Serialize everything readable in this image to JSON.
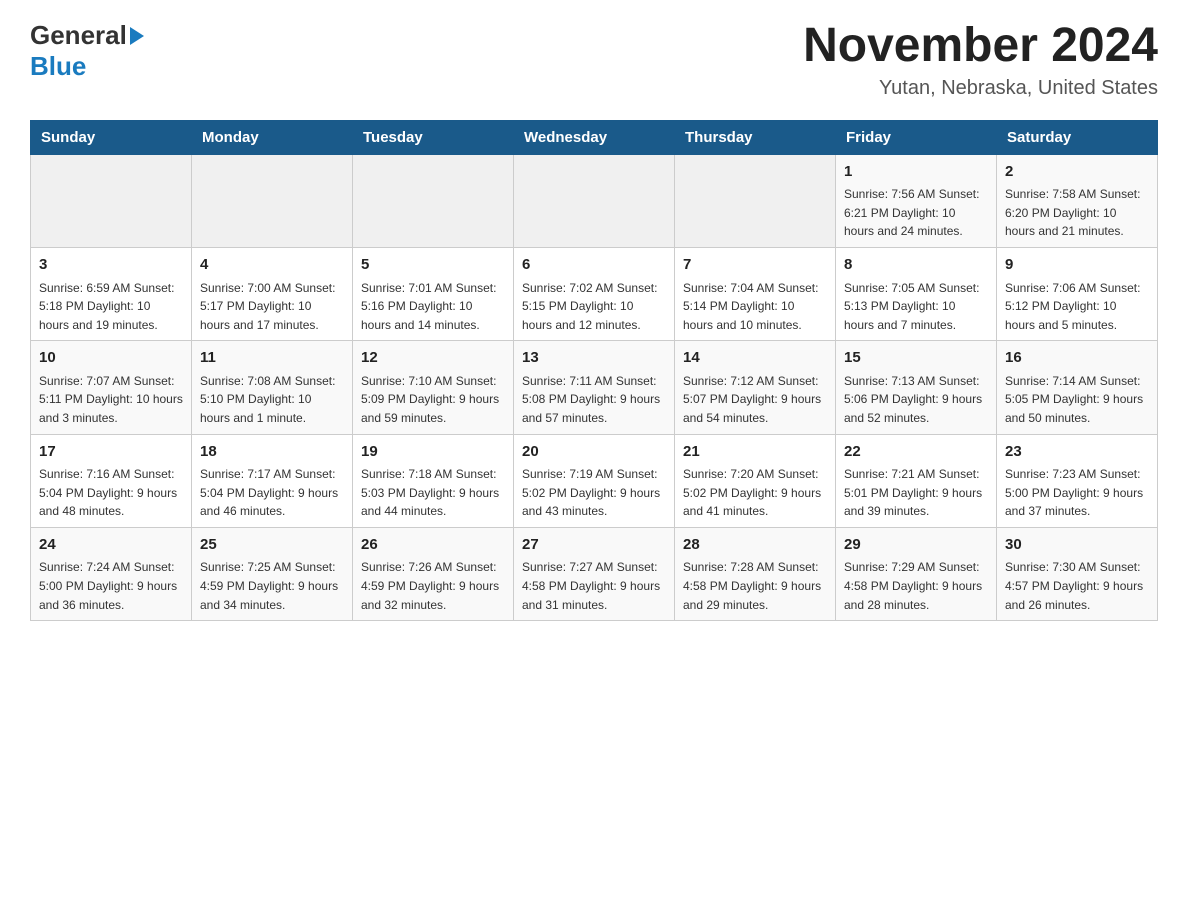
{
  "header": {
    "logo_general": "General",
    "logo_blue": "Blue",
    "month_title": "November 2024",
    "location": "Yutan, Nebraska, United States"
  },
  "weekdays": [
    "Sunday",
    "Monday",
    "Tuesday",
    "Wednesday",
    "Thursday",
    "Friday",
    "Saturday"
  ],
  "weeks": [
    [
      {
        "day": "",
        "info": ""
      },
      {
        "day": "",
        "info": ""
      },
      {
        "day": "",
        "info": ""
      },
      {
        "day": "",
        "info": ""
      },
      {
        "day": "",
        "info": ""
      },
      {
        "day": "1",
        "info": "Sunrise: 7:56 AM\nSunset: 6:21 PM\nDaylight: 10 hours\nand 24 minutes."
      },
      {
        "day": "2",
        "info": "Sunrise: 7:58 AM\nSunset: 6:20 PM\nDaylight: 10 hours\nand 21 minutes."
      }
    ],
    [
      {
        "day": "3",
        "info": "Sunrise: 6:59 AM\nSunset: 5:18 PM\nDaylight: 10 hours\nand 19 minutes."
      },
      {
        "day": "4",
        "info": "Sunrise: 7:00 AM\nSunset: 5:17 PM\nDaylight: 10 hours\nand 17 minutes."
      },
      {
        "day": "5",
        "info": "Sunrise: 7:01 AM\nSunset: 5:16 PM\nDaylight: 10 hours\nand 14 minutes."
      },
      {
        "day": "6",
        "info": "Sunrise: 7:02 AM\nSunset: 5:15 PM\nDaylight: 10 hours\nand 12 minutes."
      },
      {
        "day": "7",
        "info": "Sunrise: 7:04 AM\nSunset: 5:14 PM\nDaylight: 10 hours\nand 10 minutes."
      },
      {
        "day": "8",
        "info": "Sunrise: 7:05 AM\nSunset: 5:13 PM\nDaylight: 10 hours\nand 7 minutes."
      },
      {
        "day": "9",
        "info": "Sunrise: 7:06 AM\nSunset: 5:12 PM\nDaylight: 10 hours\nand 5 minutes."
      }
    ],
    [
      {
        "day": "10",
        "info": "Sunrise: 7:07 AM\nSunset: 5:11 PM\nDaylight: 10 hours\nand 3 minutes."
      },
      {
        "day": "11",
        "info": "Sunrise: 7:08 AM\nSunset: 5:10 PM\nDaylight: 10 hours\nand 1 minute."
      },
      {
        "day": "12",
        "info": "Sunrise: 7:10 AM\nSunset: 5:09 PM\nDaylight: 9 hours\nand 59 minutes."
      },
      {
        "day": "13",
        "info": "Sunrise: 7:11 AM\nSunset: 5:08 PM\nDaylight: 9 hours\nand 57 minutes."
      },
      {
        "day": "14",
        "info": "Sunrise: 7:12 AM\nSunset: 5:07 PM\nDaylight: 9 hours\nand 54 minutes."
      },
      {
        "day": "15",
        "info": "Sunrise: 7:13 AM\nSunset: 5:06 PM\nDaylight: 9 hours\nand 52 minutes."
      },
      {
        "day": "16",
        "info": "Sunrise: 7:14 AM\nSunset: 5:05 PM\nDaylight: 9 hours\nand 50 minutes."
      }
    ],
    [
      {
        "day": "17",
        "info": "Sunrise: 7:16 AM\nSunset: 5:04 PM\nDaylight: 9 hours\nand 48 minutes."
      },
      {
        "day": "18",
        "info": "Sunrise: 7:17 AM\nSunset: 5:04 PM\nDaylight: 9 hours\nand 46 minutes."
      },
      {
        "day": "19",
        "info": "Sunrise: 7:18 AM\nSunset: 5:03 PM\nDaylight: 9 hours\nand 44 minutes."
      },
      {
        "day": "20",
        "info": "Sunrise: 7:19 AM\nSunset: 5:02 PM\nDaylight: 9 hours\nand 43 minutes."
      },
      {
        "day": "21",
        "info": "Sunrise: 7:20 AM\nSunset: 5:02 PM\nDaylight: 9 hours\nand 41 minutes."
      },
      {
        "day": "22",
        "info": "Sunrise: 7:21 AM\nSunset: 5:01 PM\nDaylight: 9 hours\nand 39 minutes."
      },
      {
        "day": "23",
        "info": "Sunrise: 7:23 AM\nSunset: 5:00 PM\nDaylight: 9 hours\nand 37 minutes."
      }
    ],
    [
      {
        "day": "24",
        "info": "Sunrise: 7:24 AM\nSunset: 5:00 PM\nDaylight: 9 hours\nand 36 minutes."
      },
      {
        "day": "25",
        "info": "Sunrise: 7:25 AM\nSunset: 4:59 PM\nDaylight: 9 hours\nand 34 minutes."
      },
      {
        "day": "26",
        "info": "Sunrise: 7:26 AM\nSunset: 4:59 PM\nDaylight: 9 hours\nand 32 minutes."
      },
      {
        "day": "27",
        "info": "Sunrise: 7:27 AM\nSunset: 4:58 PM\nDaylight: 9 hours\nand 31 minutes."
      },
      {
        "day": "28",
        "info": "Sunrise: 7:28 AM\nSunset: 4:58 PM\nDaylight: 9 hours\nand 29 minutes."
      },
      {
        "day": "29",
        "info": "Sunrise: 7:29 AM\nSunset: 4:58 PM\nDaylight: 9 hours\nand 28 minutes."
      },
      {
        "day": "30",
        "info": "Sunrise: 7:30 AM\nSunset: 4:57 PM\nDaylight: 9 hours\nand 26 minutes."
      }
    ]
  ]
}
